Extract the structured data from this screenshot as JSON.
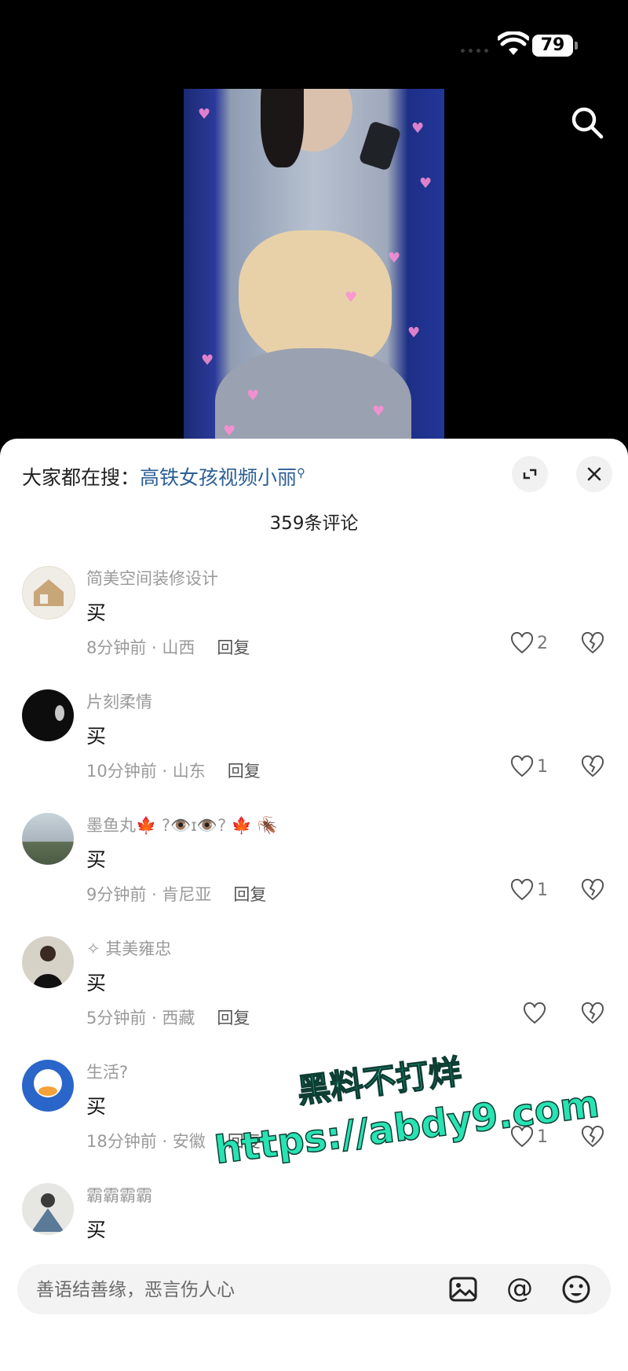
{
  "status": {
    "battery": "79"
  },
  "hot_search": {
    "prefix": "大家都在搜：",
    "keyword": "高铁女孩视频小丽"
  },
  "comment_count": "359条评论",
  "comments": [
    {
      "user": "简美空间装修设计",
      "text": "买",
      "time": "8分钟前 · 山西",
      "reply": "回复",
      "likes": "2"
    },
    {
      "user": "片刻柔情",
      "text": "买",
      "time": "10分钟前 · 山东",
      "reply": "回复",
      "likes": "1"
    },
    {
      "user": "墨鱼丸🍁 ?👁️ɪ👁️? 🍁 🪳",
      "text": "买",
      "time": "9分钟前 · 肯尼亚",
      "reply": "回复",
      "likes": "1"
    },
    {
      "user": "✧ 其美雍忠",
      "text": "买",
      "time": "5分钟前 · 西藏",
      "reply": "回复",
      "likes": ""
    },
    {
      "user": "生活?",
      "text": "买",
      "time": "18分钟前 · 安徽",
      "reply": "回复",
      "likes": "1"
    },
    {
      "user": "霸霸霸霸",
      "text": "买",
      "time": "",
      "reply": "",
      "likes": ""
    }
  ],
  "input": {
    "placeholder": "善语结善缘，恶言伤人心"
  },
  "watermark": {
    "line1": "黑料不打烊",
    "line2": "https://abdy9.com"
  },
  "colors": {
    "accent_link": "#2c5f96",
    "watermark": "#28e3b2"
  }
}
